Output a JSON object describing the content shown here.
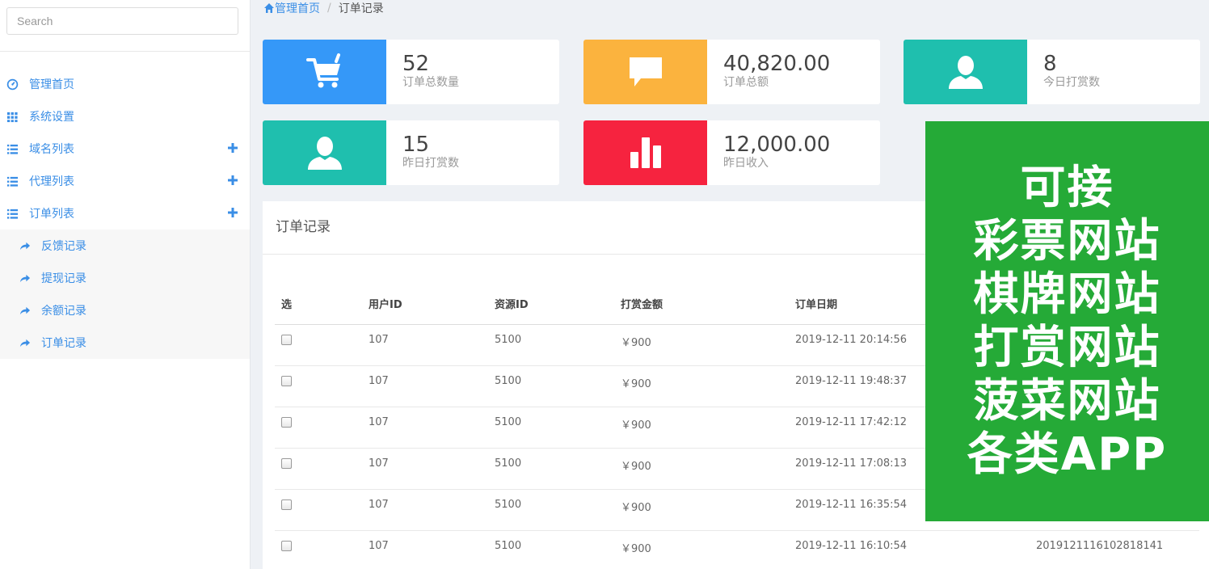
{
  "search": {
    "placeholder": "Search"
  },
  "sidebar": {
    "items": [
      {
        "label": "管理首页",
        "icon": "dashboard-icon",
        "expandable": false
      },
      {
        "label": "系统设置",
        "icon": "grid-icon",
        "expandable": false
      },
      {
        "label": "域名列表",
        "icon": "list-icon",
        "expandable": true
      },
      {
        "label": "代理列表",
        "icon": "list-icon",
        "expandable": true
      },
      {
        "label": "订单列表",
        "icon": "list-icon",
        "expandable": true
      }
    ],
    "subitems": [
      {
        "label": "反馈记录",
        "icon": "share-arrow-icon"
      },
      {
        "label": "提现记录",
        "icon": "share-arrow-icon"
      },
      {
        "label": "余额记录",
        "icon": "share-arrow-icon"
      },
      {
        "label": "订单记录",
        "icon": "share-arrow-icon"
      }
    ]
  },
  "breadcrumb": {
    "home": "管理首页",
    "separator": "/",
    "current": "订单记录"
  },
  "stats": [
    {
      "value": "52",
      "label": "订单总数量",
      "color": "#3598f8",
      "icon": "cart-icon"
    },
    {
      "value": "40,820.00",
      "label": "订单总额",
      "color": "#fbb33e",
      "icon": "comment-icon"
    },
    {
      "value": "8",
      "label": "今日打赏数",
      "color": "#1fbfae",
      "icon": "user-icon"
    },
    {
      "value": "15",
      "label": "昨日打赏数",
      "color": "#1fbfae",
      "icon": "user-icon"
    },
    {
      "value": "12,000.00",
      "label": "昨日收入",
      "color": "#f6233f",
      "icon": "bar-chart-icon"
    }
  ],
  "panel": {
    "title": "订单记录",
    "columns": [
      "选",
      "用户ID",
      "资源ID",
      "打赏金额",
      "订单日期"
    ],
    "rows": [
      {
        "user": "107",
        "resource": "5100",
        "amount": "￥900",
        "date": "2019-12-11 20:14:56",
        "order_no": ""
      },
      {
        "user": "107",
        "resource": "5100",
        "amount": "￥900",
        "date": "2019-12-11 19:48:37",
        "order_no": ""
      },
      {
        "user": "107",
        "resource": "5100",
        "amount": "￥900",
        "date": "2019-12-11 17:42:12",
        "order_no": ""
      },
      {
        "user": "107",
        "resource": "5100",
        "amount": "￥900",
        "date": "2019-12-11 17:08:13",
        "order_no": ""
      },
      {
        "user": "107",
        "resource": "5100",
        "amount": "￥900",
        "date": "2019-12-11 16:35:54",
        "order_no": ""
      },
      {
        "user": "107",
        "resource": "5100",
        "amount": "￥900",
        "date": "2019-12-11 16:10:54",
        "order_no": "2019121116102818141"
      }
    ]
  },
  "promo": {
    "lines": [
      "可接",
      "彩票网站",
      "棋牌网站",
      "打赏网站",
      "菠菜网站",
      "各类APP"
    ],
    "color": "#25aa37"
  },
  "colors": {
    "accent": "#3a8ee6"
  }
}
